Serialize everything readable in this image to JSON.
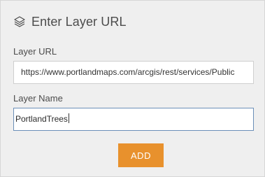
{
  "dialog": {
    "title": "Enter Layer URL",
    "icon": "layers-icon"
  },
  "fields": {
    "url_label": "Layer URL",
    "url_value": "https://www.portlandmaps.com/arcgis/rest/services/Public",
    "name_label": "Layer Name",
    "name_value": "PortlandTrees"
  },
  "buttons": {
    "add_label": "ADD"
  },
  "colors": {
    "accent": "#e8912d",
    "focus_border": "#6b8fb8",
    "panel_bg": "#efefef"
  }
}
